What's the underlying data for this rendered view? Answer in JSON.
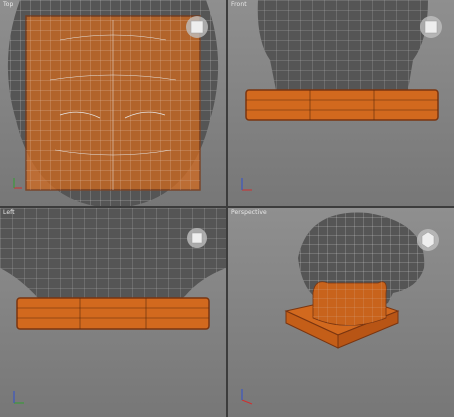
{
  "viewports": [
    {
      "id": "top",
      "label": "Top"
    },
    {
      "id": "front",
      "label": "Front"
    },
    {
      "id": "left",
      "label": "Left"
    },
    {
      "id": "perspective",
      "label": "Perspective"
    }
  ],
  "colors": {
    "viewport_bg": "#8a8a8a",
    "mesh_fill": "#5a5a5a",
    "wire": "#e8e8e8",
    "selected": "#d2691e",
    "selected_edge": "#8a3a10",
    "axis_x": "#d03030",
    "axis_y": "#30a030",
    "axis_z": "#3050d0"
  },
  "icons": {
    "viewcube": "viewcube-icon",
    "axis": "axis-gizmo-icon"
  }
}
